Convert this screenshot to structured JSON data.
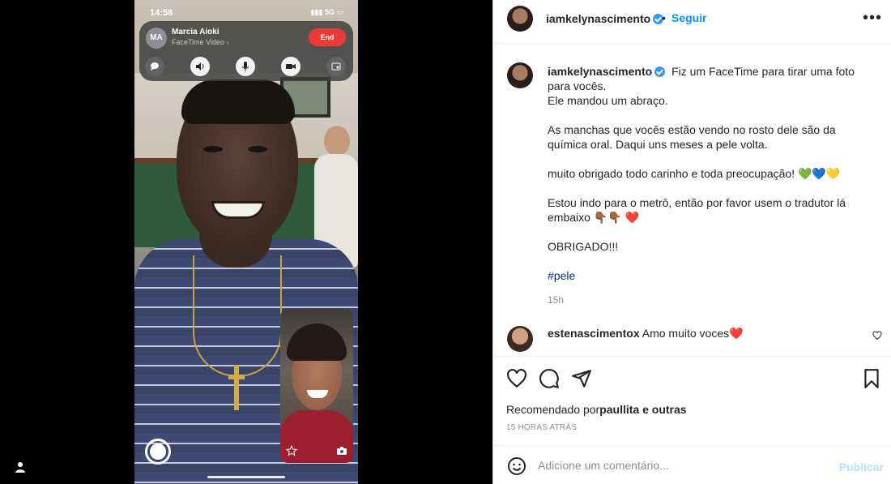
{
  "facetime": {
    "time": "14:58",
    "status": "5G",
    "caller_initials": "MA",
    "caller_name": "Marcia Aioki",
    "call_type": "FaceTime Video ›",
    "end_label": "End"
  },
  "post": {
    "username": "iamkelynascimento",
    "follow_label": "Seguir",
    "dot": "•",
    "more_label": "•••",
    "caption_lines": [
      "Fiz um FaceTime para tirar uma foto para vocês.",
      "Ele mandou um abraço.",
      "As manchas que vocês estão vendo no rosto dele são da química oral. Daqui uns meses a pele volta.",
      "muito obrigado todo carinho e toda preocupação! 💚💙💛",
      "Estou indo para o metrô, então por favor usem o tradutor lá embaixo 👇🏾👇🏾",
      "OBRIGADO!!!"
    ],
    "heart_emoji": "❤️",
    "hashtag": "#pele",
    "time_ago": "15h"
  },
  "comment": {
    "username": "estenascimentox",
    "text": "Amo muito voces",
    "heart": "❤️"
  },
  "likes": {
    "prefix": "Recomendado por",
    "user": "paullita",
    "suffix": " e outras"
  },
  "date_label": "15 HORAS ATRÁS",
  "add_comment": {
    "placeholder": "Adicione um comentário...",
    "publish_label": "Publicar"
  },
  "colors": {
    "accent": "#0095f6",
    "end_red": "#ec3b37",
    "hashtag": "#00376b"
  }
}
